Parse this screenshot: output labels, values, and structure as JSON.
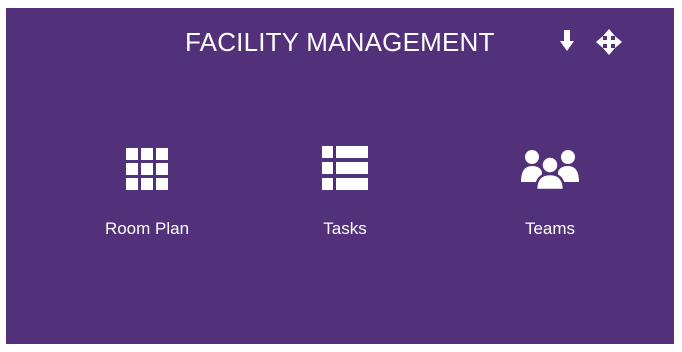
{
  "header": {
    "title": "FACILITY MANAGEMENT",
    "actions": [
      {
        "icon": "download-arrow-icon"
      },
      {
        "icon": "move-arrows-icon"
      }
    ]
  },
  "tiles": [
    {
      "label": "Room Plan",
      "icon": "grid-icon"
    },
    {
      "label": "Tasks",
      "icon": "list-icon"
    },
    {
      "label": "Teams",
      "icon": "users-icon"
    }
  ],
  "colors": {
    "panel_background": "#53307a",
    "foreground": "#ffffff",
    "page_background": "#ffffff"
  }
}
